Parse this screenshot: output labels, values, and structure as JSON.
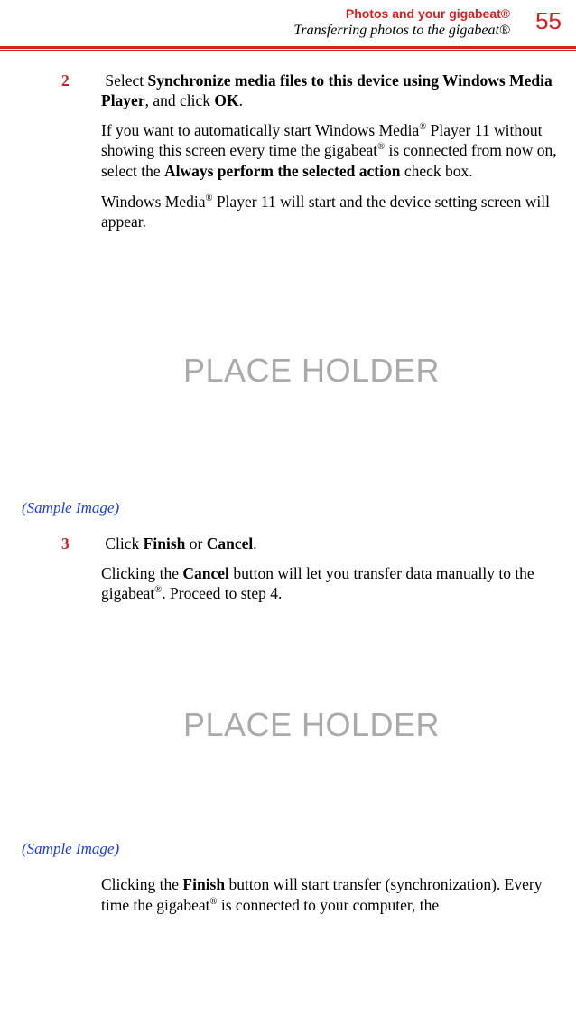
{
  "header": {
    "section": "Photos and your gigabeat®",
    "subsection": "Transferring photos to the gigabeat®",
    "page": "55"
  },
  "steps": {
    "s2": {
      "num": "2",
      "line1_a": "Select ",
      "line1_b": "Synchronize media files to this device using Windows Media Player",
      "line1_c": ", and click ",
      "line1_d": "OK",
      "line1_e": ".",
      "p2_a": "If you want to automatically start Windows Media",
      "p2_sup1": "®",
      "p2_b": " Player 11 without showing this screen every time the gigabeat",
      "p2_sup2": "®",
      "p2_c": " is connected from now on, select the ",
      "p2_d": "Always perform the selected action",
      "p2_e": " check box.",
      "p3_a": "Windows Media",
      "p3_sup1": "®",
      "p3_b": " Player 11 will start and the device setting screen will appear."
    },
    "s3": {
      "num": "3",
      "line1_a": "Click ",
      "line1_b": "Finish",
      "line1_c": " or ",
      "line1_d": "Cancel",
      "line1_e": ".",
      "p2_a": "Clicking the ",
      "p2_b": "Cancel",
      "p2_c": " button will let you transfer data manually to the gigabeat",
      "p2_sup1": "®",
      "p2_d": ". Proceed to step 4.",
      "p3_a": "Clicking the ",
      "p3_b": "Finish",
      "p3_c": " button will start transfer (synchronization). Every time the gigabeat",
      "p3_sup1": "®",
      "p3_d": " is connected to your computer, the"
    }
  },
  "placeholder": "PLACE HOLDER",
  "sample_caption": "(Sample Image)"
}
